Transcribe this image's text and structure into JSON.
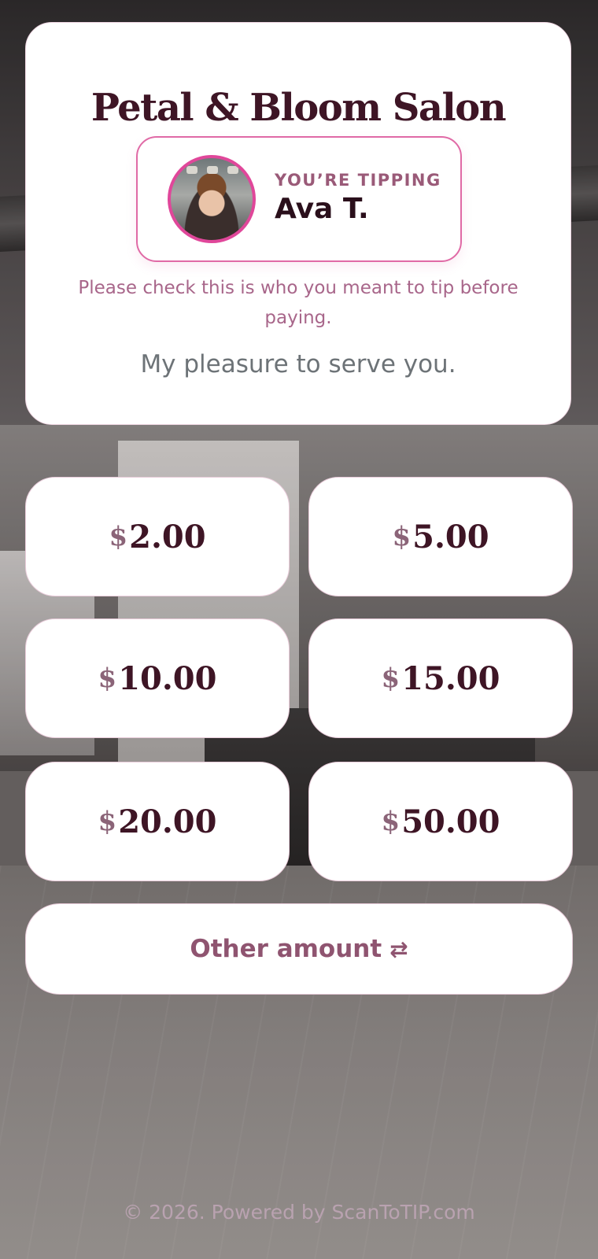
{
  "salon": {
    "name": "Petal & Bloom Salon"
  },
  "tipee": {
    "label": "YOU’RE TIPPING",
    "name": "Ava T.",
    "check_note": "Please check this is who you meant to tip before paying.",
    "tagline": "My pleasure to serve you."
  },
  "amounts": [
    {
      "currency": "$",
      "value": "2.00"
    },
    {
      "currency": "$",
      "value": "5.00"
    },
    {
      "currency": "$",
      "value": "10.00"
    },
    {
      "currency": "$",
      "value": "15.00"
    },
    {
      "currency": "$",
      "value": "20.00"
    },
    {
      "currency": "$",
      "value": "50.00"
    }
  ],
  "other": {
    "label": "Other amount",
    "icon": "swap-arrows-icon"
  },
  "footer": {
    "text": "© 2026. Powered by ScanToTIP.com"
  },
  "colors": {
    "brand": "#3e1525",
    "accent": "#e0479a",
    "muted": "#a8668a"
  }
}
